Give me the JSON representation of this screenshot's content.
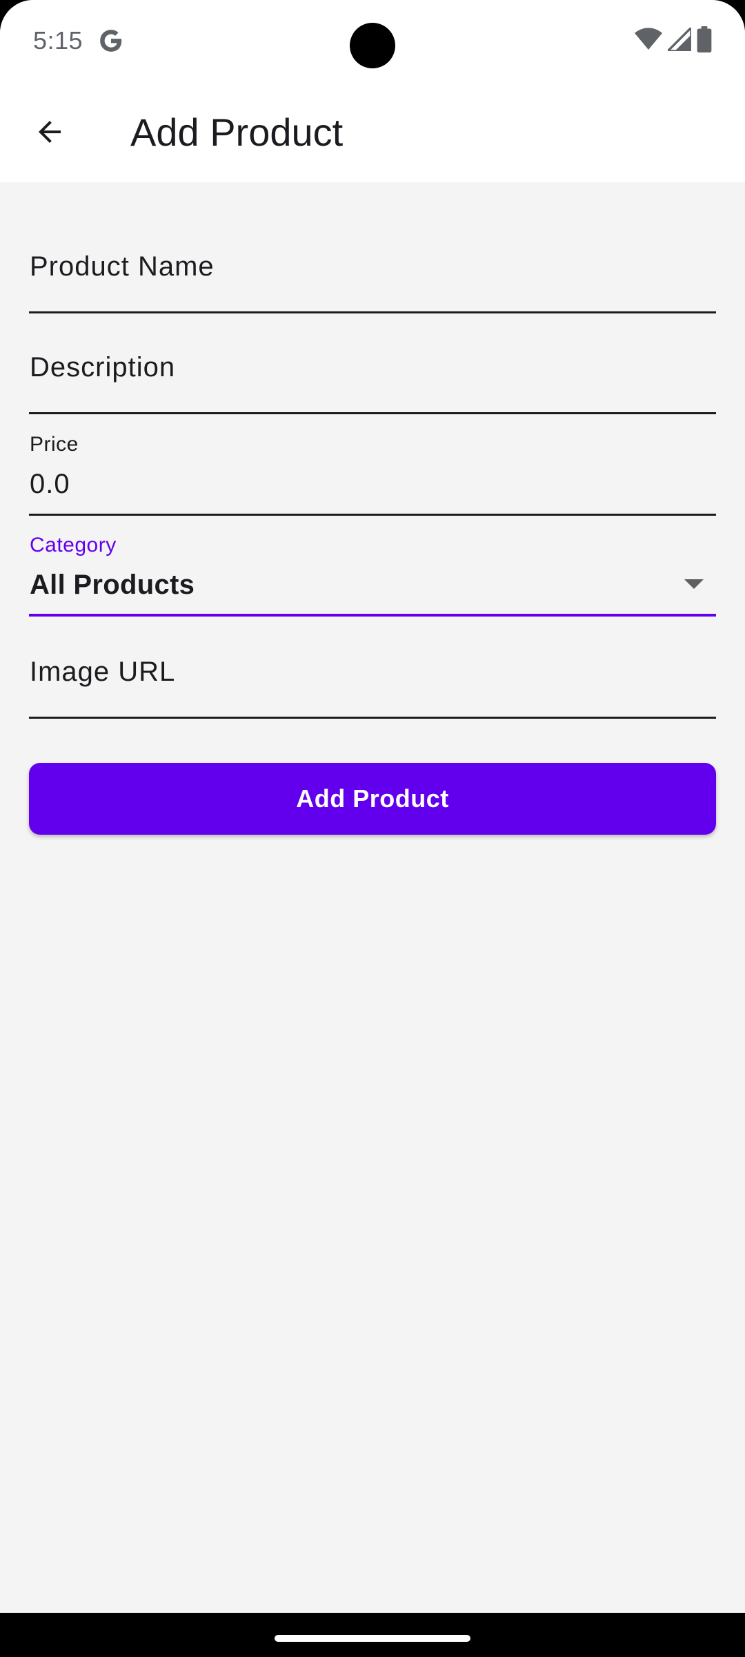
{
  "status_bar": {
    "time": "5:15",
    "icons": [
      "google-icon",
      "wifi-icon",
      "cellular-signal-icon",
      "battery-icon"
    ]
  },
  "app_bar": {
    "back_icon": "arrow-back-icon",
    "title": "Add Product"
  },
  "form": {
    "product_name": {
      "label": "Product Name",
      "value": ""
    },
    "description": {
      "label": "Description",
      "value": ""
    },
    "price": {
      "label": "Price",
      "value": "0.0"
    },
    "category": {
      "label": "Category",
      "value": "All Products",
      "focused": true
    },
    "image_url": {
      "label": "Image URL",
      "value": ""
    }
  },
  "submit_button": {
    "label": "Add Product"
  },
  "colors": {
    "accent": "#6200ee",
    "background": "#f4f4f4",
    "surface": "#ffffff",
    "text": "#1c1b1f"
  }
}
